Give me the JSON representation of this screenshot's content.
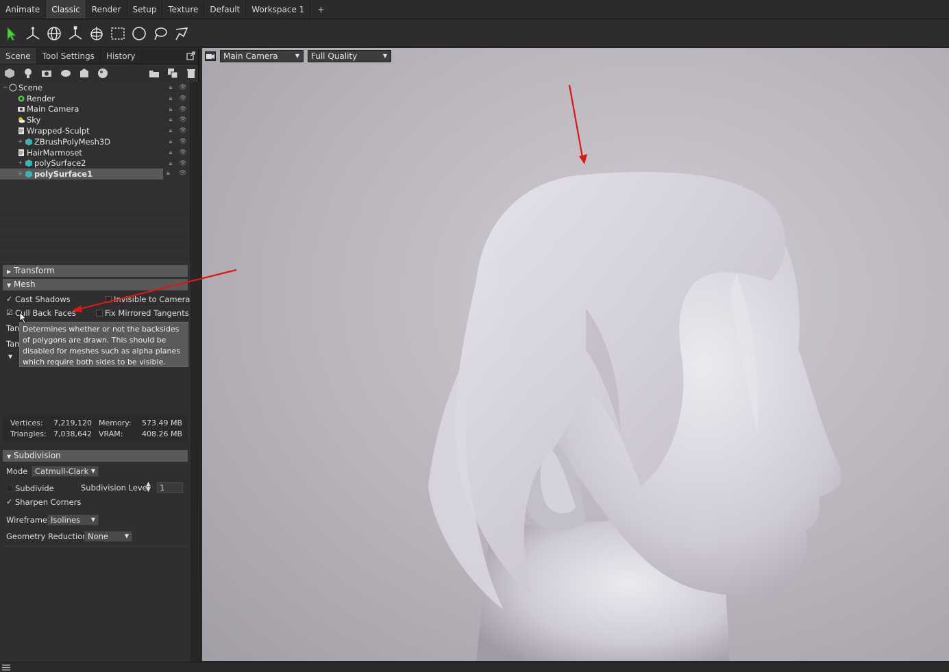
{
  "workspace_tabs": [
    "Animate",
    "Classic",
    "Render",
    "Setup",
    "Texture",
    "Default",
    "Workspace 1",
    "+"
  ],
  "active_workspace": "Classic",
  "tools": [
    "select-arrow-icon",
    "transform-axes-icon",
    "rotate-sphere-icon",
    "scale-axes-icon",
    "sphere-gizmo-icon",
    "rect-select-icon",
    "circle-select-icon",
    "lasso-select-icon",
    "polygon-select-icon"
  ],
  "panel_tabs": [
    "Scene",
    "Tool Settings",
    "History"
  ],
  "scene_tree": [
    {
      "label": "Scene",
      "icon": "scene-icon"
    },
    {
      "label": "Render",
      "icon": "render-gear-icon"
    },
    {
      "label": "Main Camera",
      "icon": "camera-icon"
    },
    {
      "label": "Sky",
      "icon": "sky-icon"
    },
    {
      "label": "Wrapped-Sculpt",
      "icon": "model-icon"
    },
    {
      "label": "ZBrushPolyMesh3D",
      "icon": "mesh-icon"
    },
    {
      "label": "HairMarmoset",
      "icon": "model-icon"
    },
    {
      "label": "polySurface2",
      "icon": "mesh-icon"
    },
    {
      "label": "polySurface1",
      "icon": "mesh-icon"
    }
  ],
  "sections": {
    "transform": "Transform",
    "mesh": "Mesh",
    "subdivision": "Subdivision"
  },
  "mesh": {
    "cast_shadows": "Cast Shadows",
    "invisible_to_camera": "Invisible to Camera",
    "cull_back_faces": "Cull Back Faces",
    "fix_mirrored_tangents": "Fix Mirrored Tangents",
    "tan1": "Tan",
    "tan2": "Tan",
    "tooltip": "Determines whether or not the backsides of polygons are drawn. This should be disabled for meshes such as alpha planes which require both sides to be visible."
  },
  "stats": {
    "vertices_label": "Vertices:",
    "vertices": "7,219,120",
    "triangles_label": "Triangles:",
    "triangles": "7,038,642",
    "memory_label": "Memory:",
    "memory": "573.49 MB",
    "vram_label": "VRAM:",
    "vram": "408.26 MB"
  },
  "subdivision": {
    "mode_label": "Mode",
    "mode_value": "Catmull-Clark",
    "subdivide": "Subdivide",
    "level_label": "Subdivision Level",
    "level_value": "1",
    "sharpen_corners": "Sharpen Corners",
    "wireframe_label": "Wireframe",
    "wireframe_value": "Isolines",
    "geometry_reduction_label": "Geometry Reduction",
    "geometry_reduction_value": "None"
  },
  "viewport": {
    "camera": "Main Camera",
    "quality": "Full Quality"
  },
  "colors": {
    "annotation_arrow": "#e01515",
    "selected_row": "#595959",
    "viewport_bg": "#b9b4bc",
    "model": "#d6d3dc"
  }
}
